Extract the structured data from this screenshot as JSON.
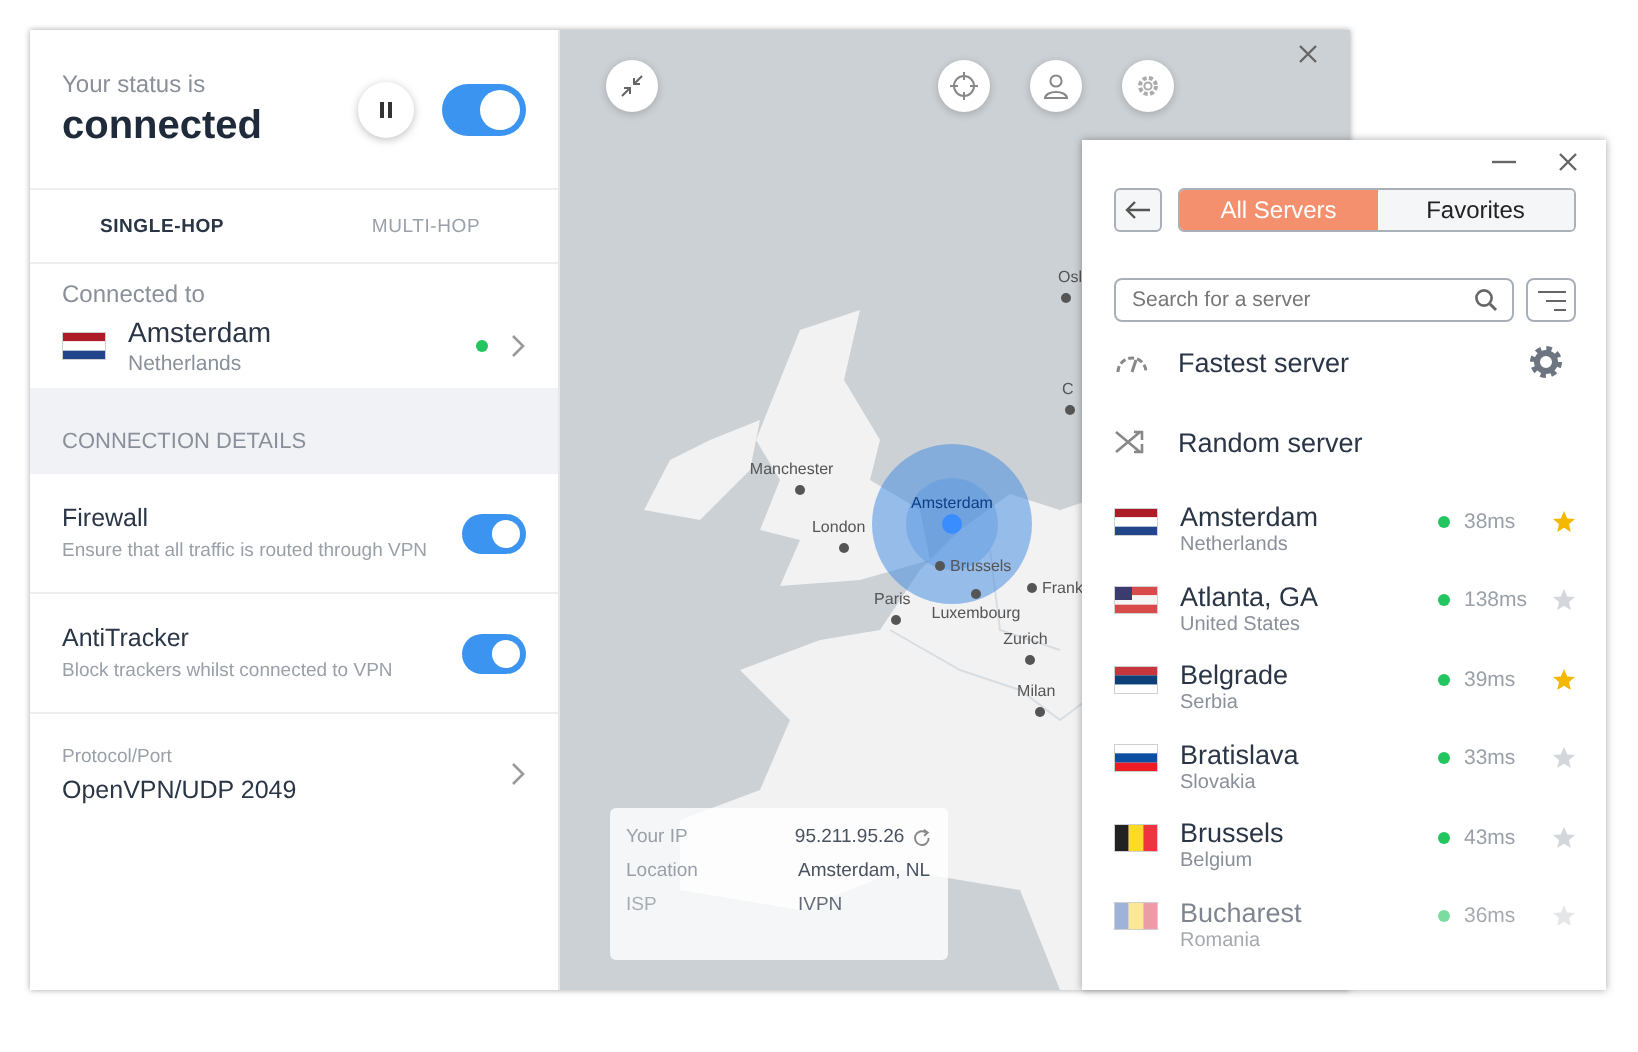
{
  "status": {
    "caption": "Your status is",
    "value": "connected",
    "connected": true
  },
  "hop_tabs": [
    {
      "label": "SINGLE-HOP",
      "selected": true
    },
    {
      "label": "MULTI-HOP",
      "selected": false
    }
  ],
  "connection": {
    "caption": "Connected to",
    "city": "Amsterdam",
    "country": "Netherlands",
    "flag": {
      "kind": "horizontal",
      "stripes": [
        {
          "color": "#ae1c28"
        },
        {
          "color": "#ffffff"
        },
        {
          "color": "#21468b"
        }
      ]
    },
    "online": true
  },
  "section_header": "CONNECTION DETAILS",
  "settings": [
    {
      "title": "Firewall",
      "description": "Ensure that all traffic is routed through VPN",
      "on": true
    },
    {
      "title": "AntiTracker",
      "description": "Block trackers whilst connected to VPN",
      "on": true
    }
  ],
  "protocol": {
    "caption": "Protocol/Port",
    "value": "OpenVPN/UDP 2049"
  },
  "map": {
    "cities": [
      {
        "name": "Osl",
        "kind": "city"
      },
      {
        "name": "C",
        "kind": "city"
      },
      {
        "name": "Manchester",
        "kind": "city"
      },
      {
        "name": "London",
        "kind": "city"
      },
      {
        "name": "Amsterdam",
        "kind": "current"
      },
      {
        "name": "Brussels",
        "kind": "city"
      },
      {
        "name": "Frank",
        "kind": "city"
      },
      {
        "name": "Paris",
        "kind": "city"
      },
      {
        "name": "Luxembourg",
        "kind": "city"
      },
      {
        "name": "Zurich",
        "kind": "city"
      },
      {
        "name": "Milan",
        "kind": "city"
      }
    ],
    "info": [
      {
        "label": "Your IP",
        "value": "95.211.95.26",
        "kind": "ip"
      },
      {
        "label": "Location",
        "value": "Amsterdam, NL",
        "kind": "text"
      },
      {
        "label": "ISP",
        "value": "IVPN",
        "kind": "text"
      }
    ]
  },
  "servers_window": {
    "tabs": [
      {
        "label": "All Servers",
        "selected": true
      },
      {
        "label": "Favorites",
        "selected": false
      }
    ],
    "search": {
      "placeholder": "Search for a server"
    },
    "specials": [
      {
        "label": "Fastest server",
        "kind": "fastest"
      },
      {
        "label": "Random server",
        "kind": "random"
      }
    ],
    "servers": [
      {
        "city": "Amsterdam",
        "country": "Netherlands",
        "flag": {
          "kind": "horizontal",
          "stripes": [
            {
              "color": "#ae1c28"
            },
            {
              "color": "#ffffff"
            },
            {
              "color": "#21468b"
            }
          ]
        },
        "ping": "38ms",
        "online": true,
        "favorite": true,
        "faded": false
      },
      {
        "city": "Atlanta, GA",
        "country": "United States",
        "flag": {
          "kind": "horizontal",
          "stripes": [
            {
              "color": "#d94a4a"
            },
            {
              "color": "#f5f5f5"
            },
            {
              "color": "#d94a4a"
            }
          ],
          "canton": {
            "color": "#3c3b6e"
          }
        },
        "ping": "138ms",
        "online": true,
        "favorite": false,
        "faded": false
      },
      {
        "city": "Belgrade",
        "country": "Serbia",
        "flag": {
          "kind": "horizontal",
          "stripes": [
            {
              "color": "#c6363c"
            },
            {
              "color": "#0c4076"
            },
            {
              "color": "#ffffff"
            }
          ]
        },
        "ping": "39ms",
        "online": true,
        "favorite": true,
        "faded": false
      },
      {
        "city": "Bratislava",
        "country": "Slovakia",
        "flag": {
          "kind": "horizontal",
          "stripes": [
            {
              "color": "#ffffff"
            },
            {
              "color": "#0b4ea2"
            },
            {
              "color": "#ee1c25"
            }
          ]
        },
        "ping": "33ms",
        "online": true,
        "favorite": false,
        "faded": false
      },
      {
        "city": "Brussels",
        "country": "Belgium",
        "flag": {
          "kind": "vertical",
          "stripes": [
            {
              "color": "#222222"
            },
            {
              "color": "#fdda24"
            },
            {
              "color": "#ef3340"
            }
          ]
        },
        "ping": "43ms",
        "online": true,
        "favorite": false,
        "faded": false
      },
      {
        "city": "Bucharest",
        "country": "Romania",
        "flag": {
          "kind": "vertical",
          "stripes": [
            {
              "color": "#9fb2d8"
            },
            {
              "color": "#fbe796"
            },
            {
              "color": "#ec9ca6"
            }
          ]
        },
        "ping": "36ms",
        "online": true,
        "favorite": false,
        "faded": true
      }
    ]
  }
}
